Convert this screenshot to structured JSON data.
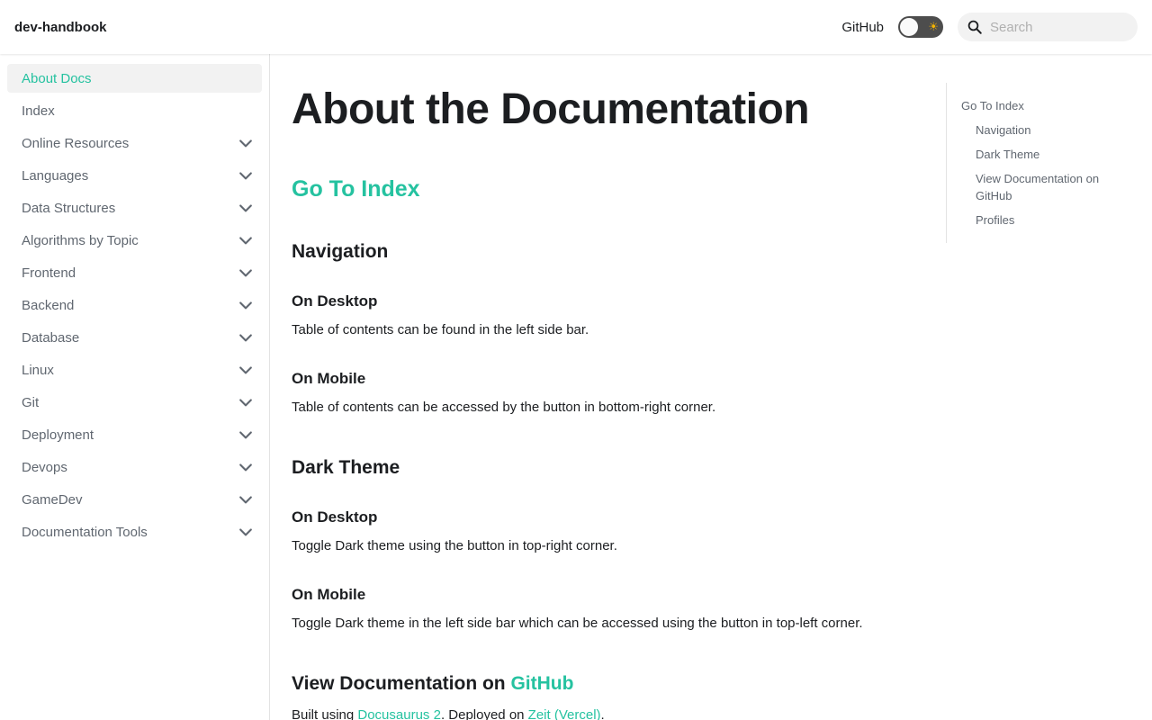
{
  "navbar": {
    "brand": "dev-handbook",
    "github_link": "GitHub",
    "theme_toggle_icon": "sun-icon",
    "search_placeholder": "Search",
    "search_value": ""
  },
  "sidebar": {
    "items": [
      {
        "label": "About Docs",
        "active": true,
        "expandable": false
      },
      {
        "label": "Index",
        "active": false,
        "expandable": false
      },
      {
        "label": "Online Resources",
        "active": false,
        "expandable": true
      },
      {
        "label": "Languages",
        "active": false,
        "expandable": true
      },
      {
        "label": "Data Structures",
        "active": false,
        "expandable": true
      },
      {
        "label": "Algorithms by Topic",
        "active": false,
        "expandable": true
      },
      {
        "label": "Frontend",
        "active": false,
        "expandable": true
      },
      {
        "label": "Backend",
        "active": false,
        "expandable": true
      },
      {
        "label": "Database",
        "active": false,
        "expandable": true
      },
      {
        "label": "Linux",
        "active": false,
        "expandable": true
      },
      {
        "label": "Git",
        "active": false,
        "expandable": true
      },
      {
        "label": "Deployment",
        "active": false,
        "expandable": true
      },
      {
        "label": "Devops",
        "active": false,
        "expandable": true
      },
      {
        "label": "GameDev",
        "active": false,
        "expandable": true
      },
      {
        "label": "Documentation Tools",
        "active": false,
        "expandable": true
      }
    ]
  },
  "content": {
    "title": "About the Documentation",
    "go_to_index": "Go To Index",
    "navigation": {
      "heading": "Navigation",
      "desktop_heading": "On Desktop",
      "desktop_text": "Table of contents can be found in the left side bar.",
      "mobile_heading": "On Mobile",
      "mobile_text": "Table of contents can be accessed by the button in bottom-right corner."
    },
    "dark_theme": {
      "heading": "Dark Theme",
      "desktop_heading": "On Desktop",
      "desktop_text": "Toggle Dark theme using the button in top-right corner.",
      "mobile_heading": "On Mobile",
      "mobile_text": "Toggle Dark theme in the left side bar which can be accessed using the button in top-left corner."
    },
    "view_docs": {
      "heading_prefix": "View Documentation on ",
      "heading_link": "GitHub",
      "built_prefix": "Built using ",
      "docusaurus_link": "Docusaurus 2",
      "deployed_prefix": ". Deployed on ",
      "zeit_link": "Zeit (Vercel)",
      "suffix": "."
    }
  },
  "toc": {
    "items": [
      "Go To Index",
      "Navigation",
      "Dark Theme",
      "View Documentation on GitHub",
      "Profiles"
    ]
  },
  "colors": {
    "primary": "#25c2a0",
    "text": "#1c1e21",
    "muted": "#606770"
  }
}
